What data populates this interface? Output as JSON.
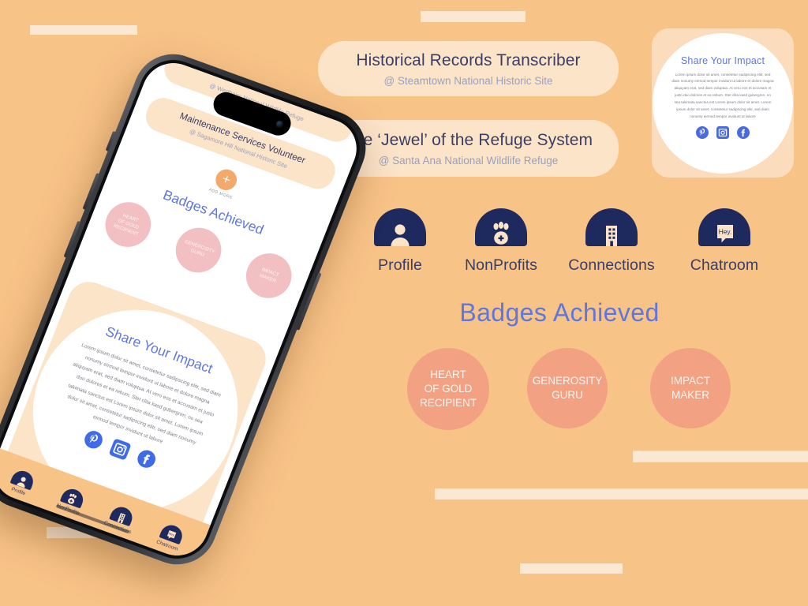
{
  "theme": {
    "background": "#f8c387",
    "cream": "#fce8d2",
    "card_peach": "#fce4c9",
    "navy": "#1e2a5e",
    "blue_accent": "#5f77da",
    "badge_salmon": "#f2a183",
    "badge_pink_phone": "#f2c0c3",
    "text_dark": "#3a3e66",
    "text_muted": "#9aa0bb"
  },
  "job_cards": [
    {
      "title": "Historical Records Transcriber",
      "org": "@ Steamtown National Historic Site"
    },
    {
      "title": "The ‘Jewel’ of the Refuge System",
      "org": "@ Santa Ana National Wildlife Refuge"
    }
  ],
  "impact_card": {
    "title": "Share Your Impact",
    "body": "Lorem ipsum dolor sit amet, consetetur sadipscing elitr, sed diam nonumy eirmod tempor invidunt ut labore et dolore magna aliquyam erat, sed diam voluptua. At vero eos et accusam et justo duo dolores et ea rebum. Stet clita kasd gubergren, no sea takimata sanctus est Lorem ipsum dolor sit amet. Lorem ipsum dolor sit amet, consetetur sadipscing elitr, sed diam nonumy eirmod tempor invidunt ut labore",
    "socials": [
      {
        "name": "pinterest-icon",
        "label": "Pinterest"
      },
      {
        "name": "instagram-icon",
        "label": "Instagram"
      },
      {
        "name": "facebook-icon",
        "label": "Facebook"
      }
    ]
  },
  "nav": {
    "items": [
      {
        "label": "Profile",
        "icon": "person-icon"
      },
      {
        "label": "NonProfits",
        "icon": "paw-icon"
      },
      {
        "label": "Connections",
        "icon": "building-icon"
      },
      {
        "label": "Chatroom",
        "icon": "speech-bubble-icon"
      }
    ],
    "chat_bubble_text": "Hey."
  },
  "badges": {
    "heading": "Badges Achieved",
    "items": [
      {
        "line1": "HEART",
        "line2": "OF GOLD",
        "line3": "RECIPIENT"
      },
      {
        "line1": "GENEROSITY",
        "line2": "GURU",
        "line3": ""
      },
      {
        "line1": "IMPACT",
        "line2": "MAKER",
        "line3": ""
      }
    ]
  },
  "phone": {
    "top_card_org": "@ Wertheim National Wildlife Refuge",
    "active_card": {
      "title": "Maintenance Services Volunteer",
      "org": "@ Sagamore Hill National Historic Site"
    },
    "add_more": {
      "plus": "+",
      "label": "ADD MORE"
    }
  }
}
